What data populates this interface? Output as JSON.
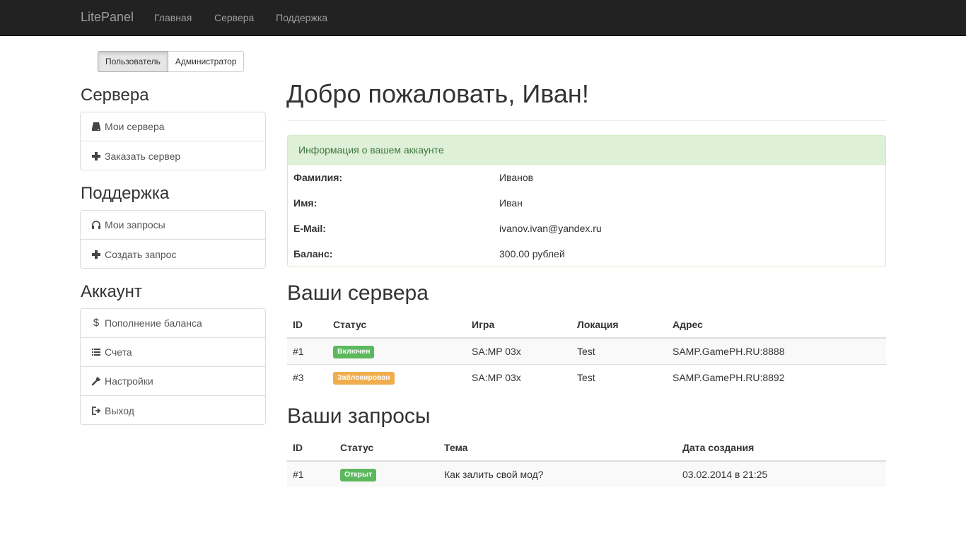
{
  "navbar": {
    "brand": "LitePanel",
    "links": [
      "Главная",
      "Сервера",
      "Поддержка"
    ]
  },
  "role_switch": {
    "user": "Пользователь",
    "admin": "Администратор",
    "active": "user"
  },
  "sidebar": {
    "servers_title": "Сервера",
    "servers_items": [
      {
        "label": "Мои сервера",
        "icon": "hdd-icon"
      },
      {
        "label": "Заказать сервер",
        "icon": "plus-icon"
      }
    ],
    "support_title": "Поддержка",
    "support_items": [
      {
        "label": "Мои запросы",
        "icon": "headphones-icon"
      },
      {
        "label": "Создать запрос",
        "icon": "plus-icon"
      }
    ],
    "account_title": "Аккаунт",
    "account_items": [
      {
        "label": "Пополнение баланса",
        "icon": "dollar-icon"
      },
      {
        "label": "Счета",
        "icon": "list-icon"
      },
      {
        "label": "Настройки",
        "icon": "wrench-icon"
      },
      {
        "label": "Выход",
        "icon": "logout-icon"
      }
    ]
  },
  "main": {
    "welcome": "Добро пожаловать, Иван!",
    "account_panel": {
      "title": "Информация о вашем аккаунте",
      "rows": [
        {
          "label": "Фамилия:",
          "value": "Иванов"
        },
        {
          "label": "Имя:",
          "value": "Иван"
        },
        {
          "label": "E-Mail:",
          "value": "ivanov.ivan@yandex.ru"
        },
        {
          "label": "Баланс:",
          "value": "300.00 рублей"
        }
      ]
    },
    "servers": {
      "title": "Ваши сервера",
      "columns": [
        "ID",
        "Статус",
        "Игра",
        "Локация",
        "Адрес"
      ],
      "rows": [
        {
          "id": "#1",
          "status": "Включен",
          "status_color": "#5cb85c",
          "game": "SA:MP 03x",
          "location": "Test",
          "address": "SAMP.GamePH.RU:8888"
        },
        {
          "id": "#3",
          "status": "Заблокирован",
          "status_color": "#f0ad4e",
          "game": "SA:MP 03x",
          "location": "Test",
          "address": "SAMP.GamePH.RU:8892"
        }
      ]
    },
    "requests": {
      "title": "Ваши запросы",
      "columns": [
        "ID",
        "Статус",
        "Тема",
        "Дата создания"
      ],
      "rows": [
        {
          "id": "#1",
          "status": "Открыт",
          "status_color": "#5cb85c",
          "topic": "Как залить свой мод?",
          "date": "03.02.2014 в 21:25"
        }
      ]
    }
  },
  "colors": {
    "navbar": "#222222",
    "panel_head": "#dff0d8",
    "success": "#5cb85c",
    "warning": "#f0ad4e"
  }
}
